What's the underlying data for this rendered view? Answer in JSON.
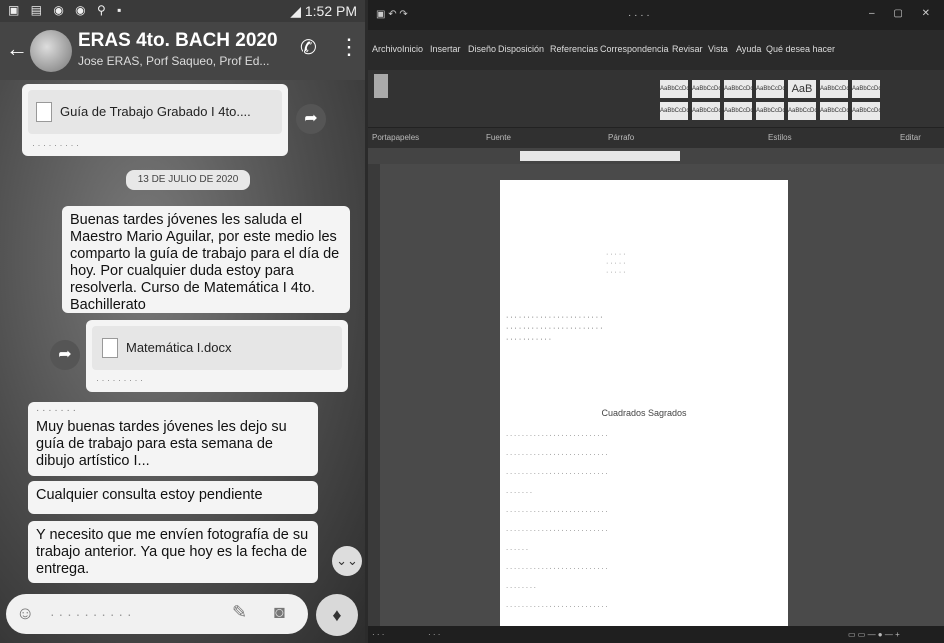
{
  "phone": {
    "status_time": "1:52 PM",
    "chat_title": "ERAS 4to. BACH 2020",
    "chat_subtitle": "Jose ERAS, Porf Saqueo, Prof Ed...",
    "messages": {
      "doc1_name": "Guía de Trabajo Grabado I 4to....",
      "date_chip": "13 DE JULIO DE 2020",
      "msg1": "Buenas tardes jóvenes les saluda el Maestro Mario Aguilar, por este medio les comparto la guía de trabajo para el día de hoy. Por cualquier duda estoy para resolverla. Curso de  Matemática I 4to. Bachillerato",
      "doc2_name": "Matemática I.docx",
      "msg2": "Muy buenas tardes jóvenes les dejo su guía de trabajo para esta semana de dibujo artístico I...",
      "msg3": "Cualquier consulta estoy pendiente",
      "msg4": "Y necesito que me envíen fotografía de su trabajo anterior.  Ya que hoy es la fecha de entrega."
    }
  },
  "word": {
    "tabs": [
      "Archivo",
      "Inicio",
      "Insertar",
      "Diseño",
      "Disposición",
      "Referencias",
      "Correspondencia",
      "Revisar",
      "Vista",
      "Ayuda",
      "Qué desea hacer"
    ],
    "groups": [
      "Portapapeles",
      "Fuente",
      "Párrafo",
      "Estilos",
      "Editar"
    ],
    "style_label": "AaBbCcDc",
    "style_big": "AaB",
    "page": {
      "heading": "Cuadrados Sagrados"
    }
  }
}
